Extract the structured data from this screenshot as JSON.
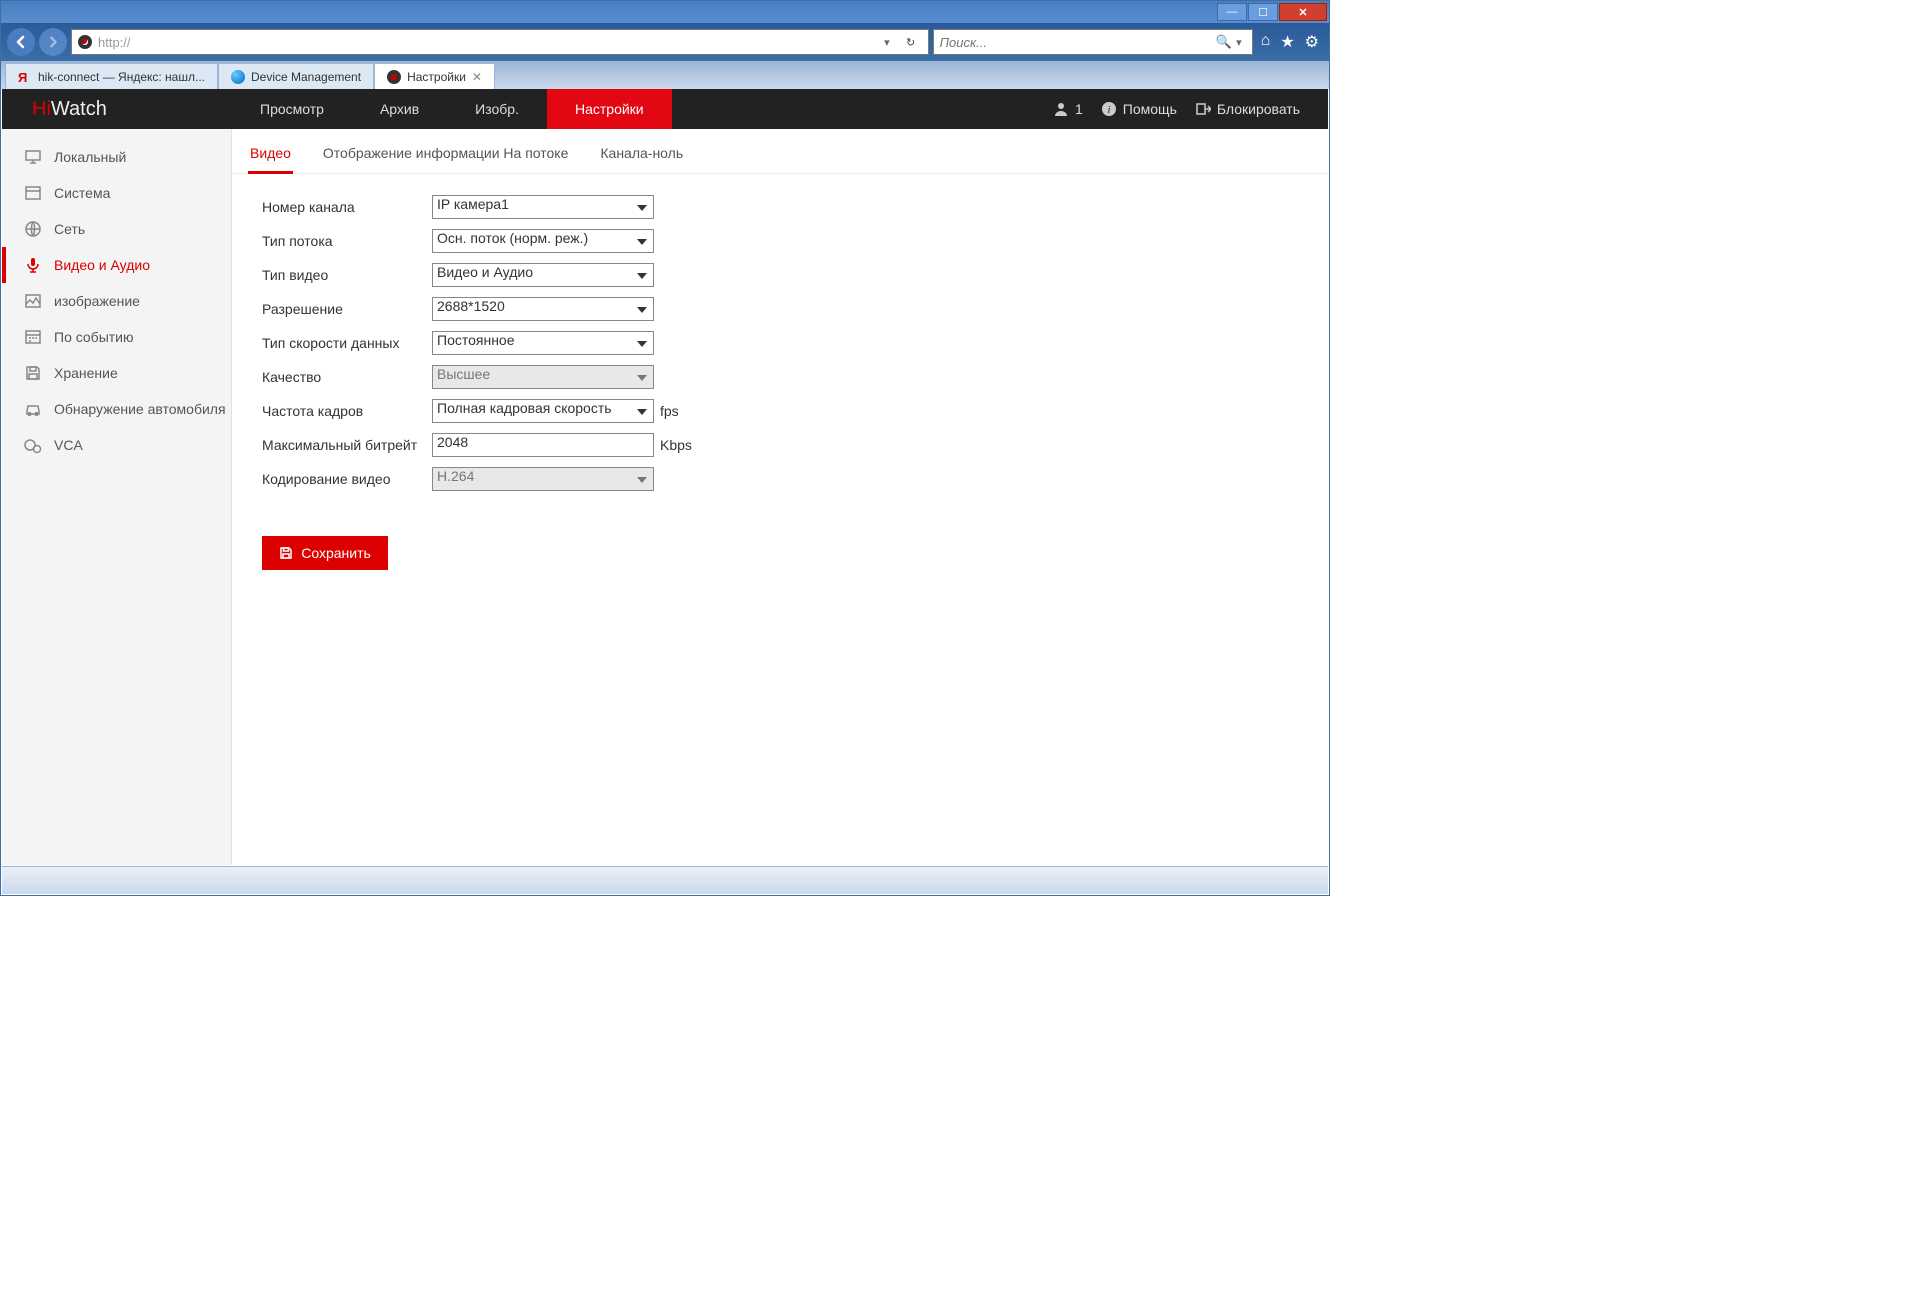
{
  "browser": {
    "address": "http://",
    "search_placeholder": "Поиск...",
    "tabs": [
      {
        "label": "hik-connect — Яндекс: нашл..."
      },
      {
        "label": "Device Management"
      },
      {
        "label": "Настройки"
      }
    ]
  },
  "app": {
    "logo_hi": "Hi",
    "logo_watch": "Watch",
    "nav": [
      {
        "label": "Просмотр"
      },
      {
        "label": "Архив"
      },
      {
        "label": "Изобр."
      },
      {
        "label": "Настройки"
      }
    ],
    "header_right": {
      "user_count": "1",
      "help": "Помощь",
      "lock": "Блокировать"
    },
    "sidebar": [
      {
        "label": "Локальный"
      },
      {
        "label": "Система"
      },
      {
        "label": "Сеть"
      },
      {
        "label": "Видео и Аудио"
      },
      {
        "label": "изображение"
      },
      {
        "label": "По событию"
      },
      {
        "label": "Хранение"
      },
      {
        "label": "Обнаружение автомобиля"
      },
      {
        "label": "VCA"
      }
    ],
    "sub_tabs": [
      {
        "label": "Видео"
      },
      {
        "label": "Отображение информации На потоке"
      },
      {
        "label": "Канала-ноль"
      }
    ],
    "form": {
      "channel_label": "Номер канала",
      "channel_value": "IP камера1",
      "stream_type_label": "Тип потока",
      "stream_type_value": "Осн. поток (норм. реж.)",
      "video_type_label": "Тип видео",
      "video_type_value": "Видео и Аудио",
      "resolution_label": "Разрешение",
      "resolution_value": "2688*1520",
      "bitrate_type_label": "Тип скорости данных",
      "bitrate_type_value": "Постоянное",
      "quality_label": "Качество",
      "quality_value": "Высшее",
      "framerate_label": "Частота кадров",
      "framerate_value": "Полная кадровая скорость",
      "framerate_suffix": "fps",
      "max_bitrate_label": "Максимальный битрейт",
      "max_bitrate_value": "2048",
      "max_bitrate_suffix": "Kbps",
      "encoding_label": "Кодирование видео",
      "encoding_value": "H.264",
      "save_label": "Сохранить"
    }
  }
}
